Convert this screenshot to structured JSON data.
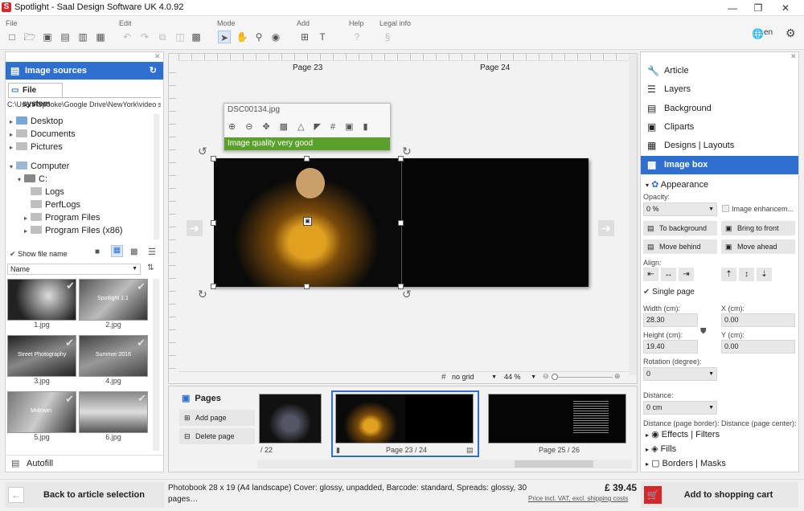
{
  "window": {
    "title": "Spotlight - Saal Design Software UK 4.0.92",
    "logo": "S"
  },
  "toolbar": {
    "groups": {
      "file": "File",
      "edit": "Edit",
      "mode": "Mode",
      "add": "Add",
      "help": "Help",
      "legal": "Legal info"
    },
    "language": "en"
  },
  "left": {
    "header": "Image sources",
    "tab": "File system",
    "path": "C:\\Users\\Spooke\\Google Drive\\NewYork\\video s",
    "tree": [
      "Desktop",
      "Documents",
      "Pictures",
      "Computer",
      "C:",
      "Logs",
      "PerfLogs",
      "Program Files",
      "Program Files (x86)"
    ],
    "show_file_name": "Show file name",
    "sort": "Name",
    "thumbs": [
      "1.jpg",
      "2.jpg",
      "3.jpg",
      "4.jpg",
      "5.jpg",
      "6.jpg"
    ],
    "thumb_overlays": [
      "",
      "Spotlight 1.1",
      "Street Photography",
      "Summer 2016",
      "Midtown",
      ""
    ],
    "autofill": "Autofill"
  },
  "canvas": {
    "page_left": "Page 23",
    "page_right": "Page 24",
    "popup_filename": "DSC00134.jpg",
    "quality": "Image quality very good",
    "grid": "no grid",
    "zoom": "44 %"
  },
  "pages": {
    "title": "Pages",
    "add": "Add page",
    "delete": "Delete page",
    "labels": [
      "/ 22",
      "Page 23 / 24",
      "Page 25 / 26"
    ]
  },
  "right": {
    "menu": [
      "Article",
      "Layers",
      "Background",
      "Cliparts",
      "Designs | Layouts",
      "Image box"
    ],
    "appearance": "Appearance",
    "opacity_label": "Opacity:",
    "opacity": "0 %",
    "image_enhancement": "Image enhancem...",
    "to_background": "To background",
    "bring_to_front": "Bring to front",
    "move_behind": "Move behind",
    "move_ahead": "Move ahead",
    "align": "Align:",
    "single_page": "Single page",
    "width_label": "Width (cm):",
    "width": "28.30",
    "height_label": "Height (cm):",
    "height": "19.40",
    "x_label": "X (cm):",
    "x": "0.00",
    "y_label": "Y (cm):",
    "y": "0.00",
    "rotation_label": "Rotation (degree):",
    "rotation": "0",
    "distance_label": "Distance:",
    "distance": "0 cm",
    "distance_border": "Distance (page border):",
    "distance_center": "Distance (page center):",
    "sections": [
      "Effects | Filters",
      "Fills",
      "Borders | Masks"
    ]
  },
  "footer": {
    "back": "Back to article selection",
    "description": "Photobook 28 x 19 (A4 landscape) Cover: glossy, unpadded, Barcode: standard, Spreads: glossy, 30 pages…",
    "price": "£ 39.45",
    "price_note": "Price incl. VAT, excl. shipping costs",
    "cart": "Add to shopping cart"
  },
  "colors": {
    "accent": "#2f6fcf",
    "quality_ok": "#5ba02a",
    "cart": "#d9262b"
  }
}
